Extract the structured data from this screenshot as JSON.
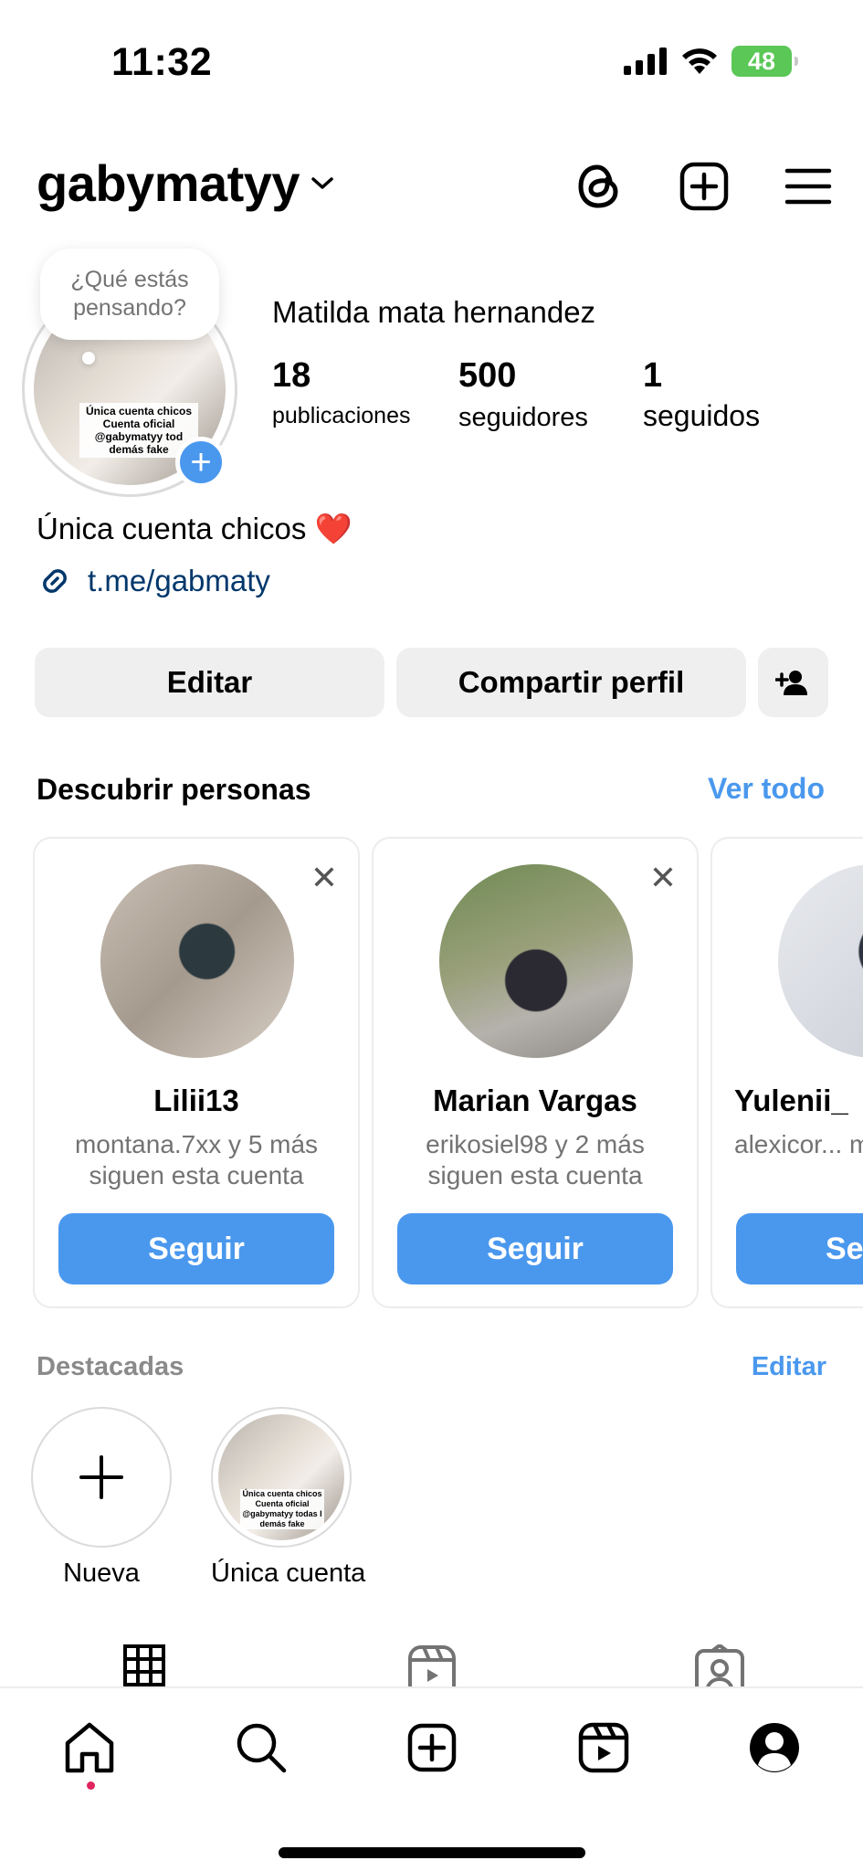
{
  "status_bar": {
    "time": "11:32",
    "battery": "48"
  },
  "header": {
    "username": "gabymatyy"
  },
  "profile": {
    "thought_bubble": "¿Qué estás pensando?",
    "avatar_caption": "Única cuenta chicos Cuenta oficial @gabymatyy tod demás fake",
    "display_name": "Matilda mata hernandez",
    "stats": [
      {
        "value": "18",
        "label": "publicaciones"
      },
      {
        "value": "500",
        "label": "seguidores"
      },
      {
        "value": "1",
        "label": "seguidos"
      }
    ],
    "bio": "Única cuenta chicos",
    "bio_emoji": "❤️",
    "link": "t.me/gabmaty"
  },
  "actions": {
    "edit": "Editar",
    "share": "Compartir perfil"
  },
  "discover": {
    "title": "Descubrir personas",
    "see_all": "Ver todo",
    "cards": [
      {
        "name": "Lilii13",
        "subtitle": "montana.7xx y 5 más siguen esta cuenta",
        "button": "Seguir"
      },
      {
        "name": "Marian Vargas",
        "subtitle": "erikosiel98 y 2 más siguen esta cuenta",
        "button": "Seguir"
      },
      {
        "name": "Yulenii_",
        "subtitle": "alexicor... más sigue...",
        "button": "Se"
      }
    ]
  },
  "highlights": {
    "title": "Destacadas",
    "edit": "Editar",
    "items": [
      {
        "label": "Nueva"
      },
      {
        "label": "Única cuenta",
        "caption": "Única cuenta chicos Cuenta oficial @gabymatyy todas l demás fake"
      }
    ]
  },
  "colors": {
    "accent": "#4a98ee",
    "button_bg": "#efefef",
    "battery": "#5ac756",
    "link": "#00376b"
  }
}
